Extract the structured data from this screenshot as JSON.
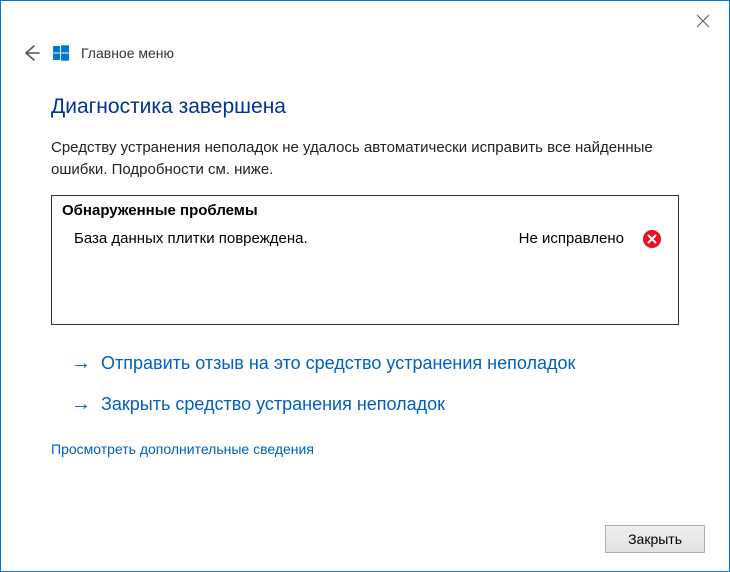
{
  "header": {
    "breadcrumb": "Главное меню"
  },
  "main": {
    "title": "Диагностика завершена",
    "summary": "Средству устранения неполадок не удалось автоматически исправить все найденные ошибки. Подробности см. ниже.",
    "problems_header": "Обнаруженные проблемы",
    "problems": [
      {
        "description": "База данных плитки повреждена.",
        "status": "Не исправлено"
      }
    ],
    "actions": {
      "feedback": "Отправить отзыв на это средство устранения неполадок",
      "close_tool": "Закрыть средство устранения неполадок"
    },
    "details_link": "Просмотреть дополнительные сведения"
  },
  "footer": {
    "close_label": "Закрыть"
  }
}
